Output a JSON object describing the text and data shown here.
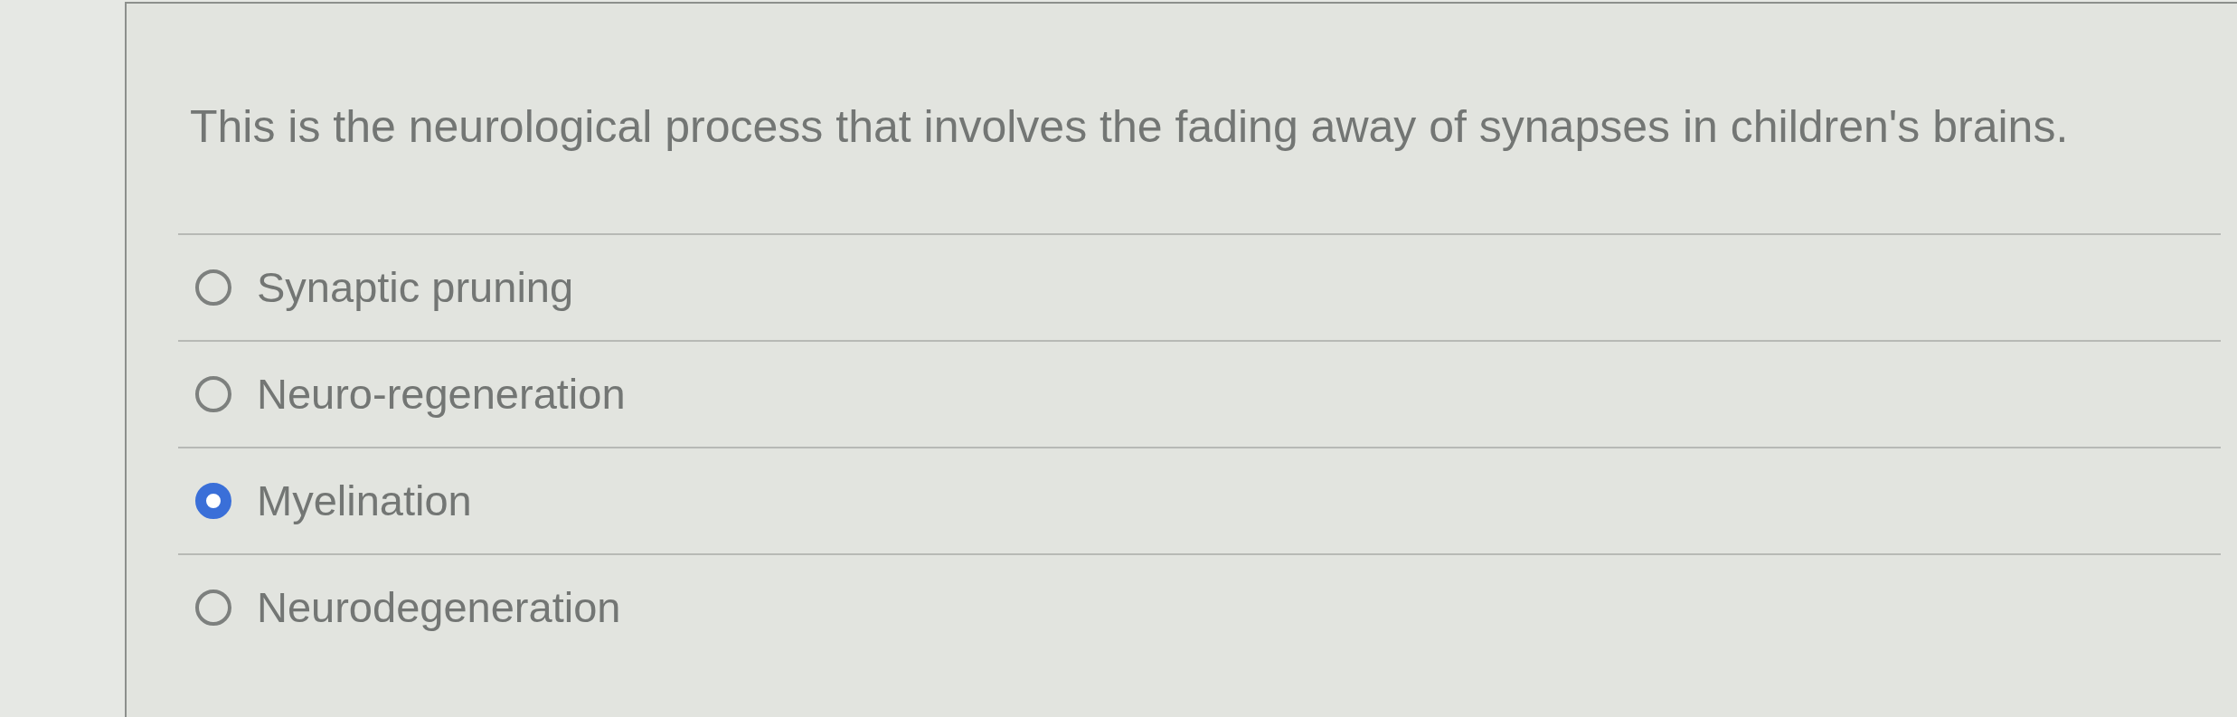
{
  "question": "This is the neurological process that involves the fading away of synapses in children's brains.",
  "options": [
    {
      "label": "Synaptic pruning",
      "selected": false
    },
    {
      "label": "Neuro-regeneration",
      "selected": false
    },
    {
      "label": "Myelination",
      "selected": true
    },
    {
      "label": "Neurodegeneration",
      "selected": false
    }
  ]
}
